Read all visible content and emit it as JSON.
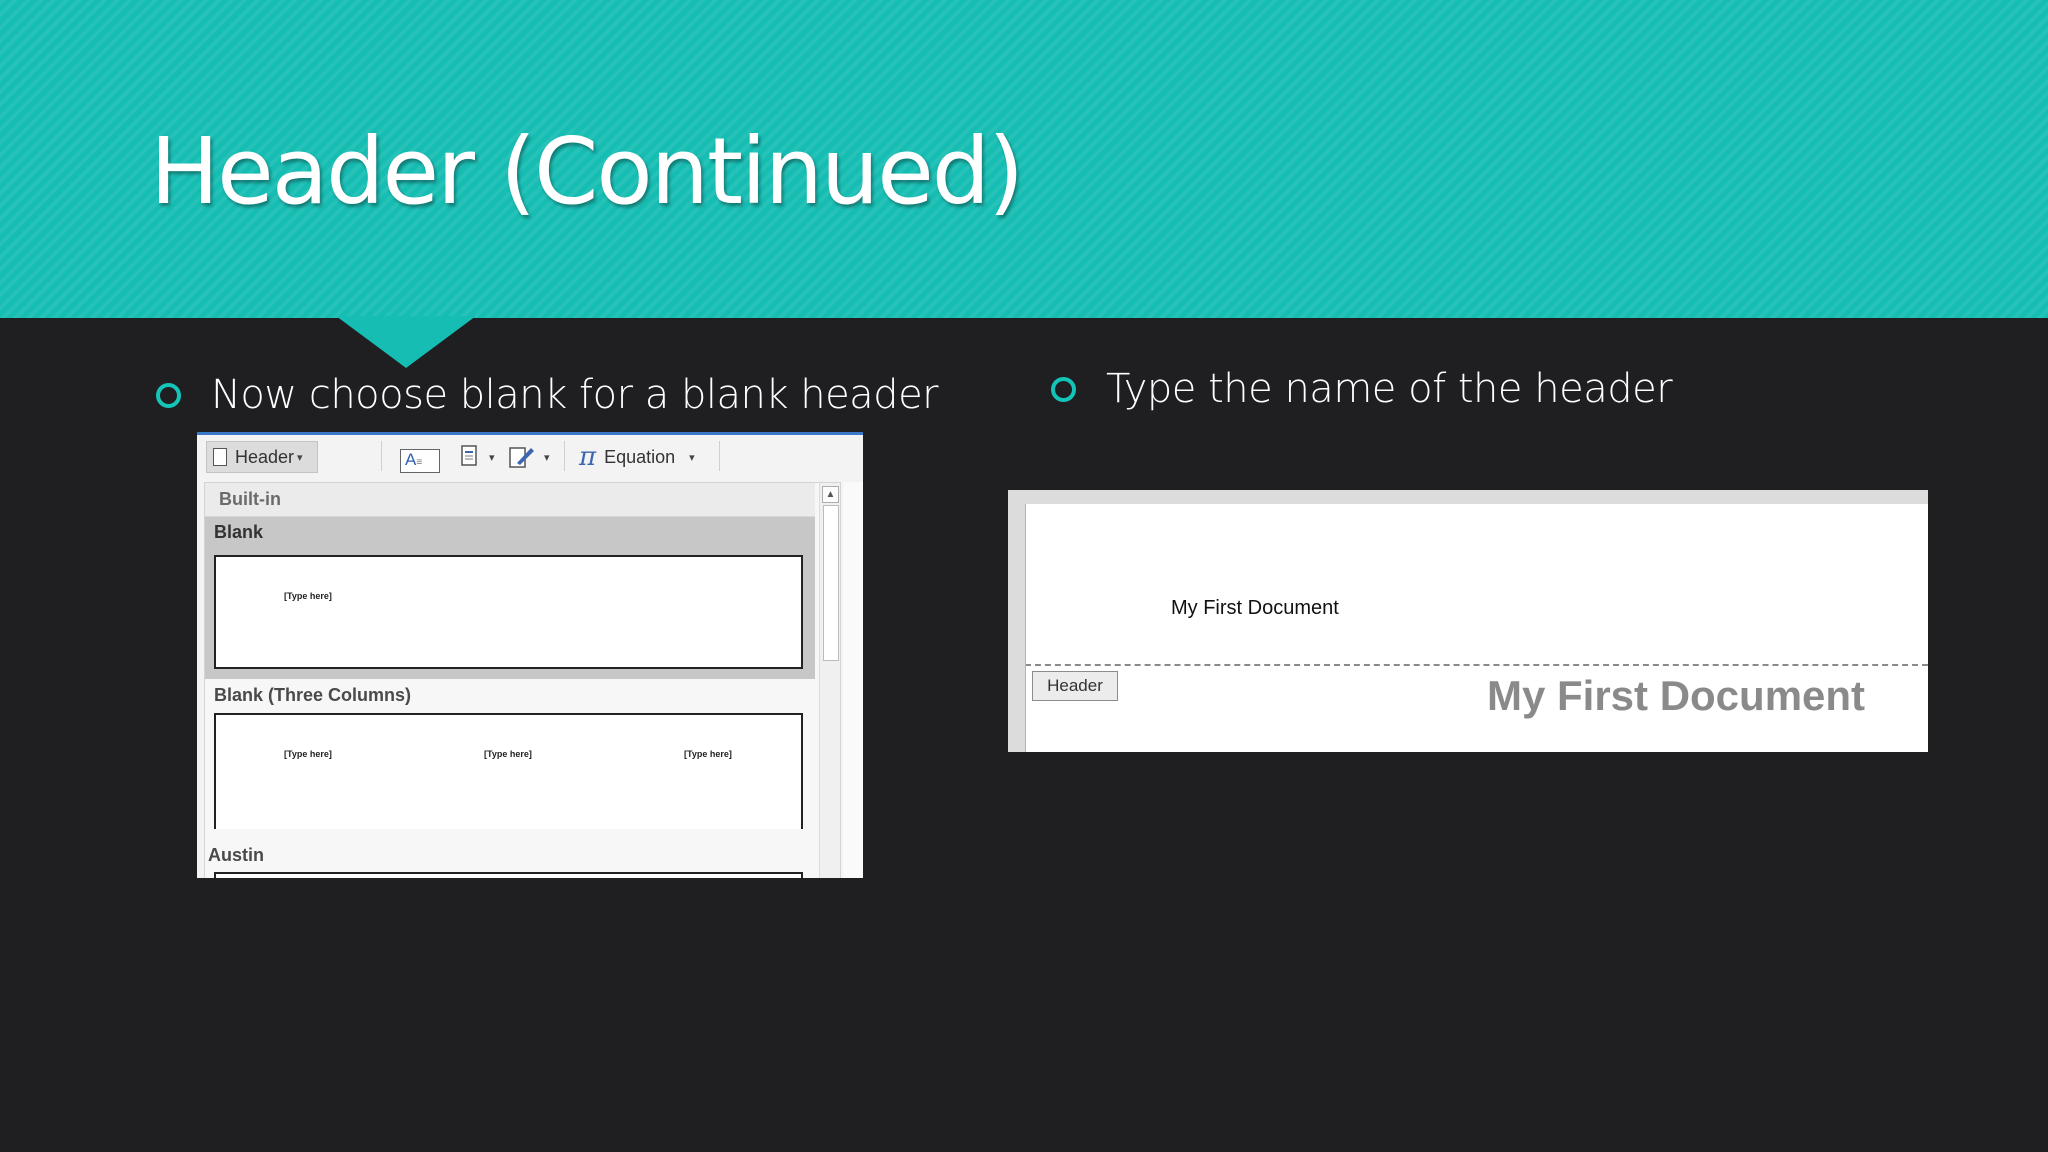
{
  "slide": {
    "title": "Header (Continued)",
    "accent_color": "#16bdb3",
    "background_color": "#1f1f21"
  },
  "bullets": {
    "left": "Now choose blank for a blank header",
    "right": "Type the name of the header"
  },
  "ribbon": {
    "header_label": "Header",
    "equation_label": "Equation",
    "icons": [
      "document-icon",
      "textbox-icon",
      "quick-parts-icon",
      "signature-line-icon",
      "pi-icon"
    ]
  },
  "gallery": {
    "section_heading": "Built-in",
    "items": [
      {
        "label": "Blank",
        "placeholders": [
          "[Type here]"
        ],
        "selected": true
      },
      {
        "label": "Blank (Three Columns)",
        "placeholders": [
          "[Type here]",
          "[Type here]",
          "[Type here]"
        ],
        "selected": false
      },
      {
        "label": "Austin",
        "placeholders": [],
        "selected": false
      }
    ]
  },
  "document": {
    "header_text": "My First Document",
    "header_tag": "Header",
    "body_header_text": "My First Document"
  }
}
